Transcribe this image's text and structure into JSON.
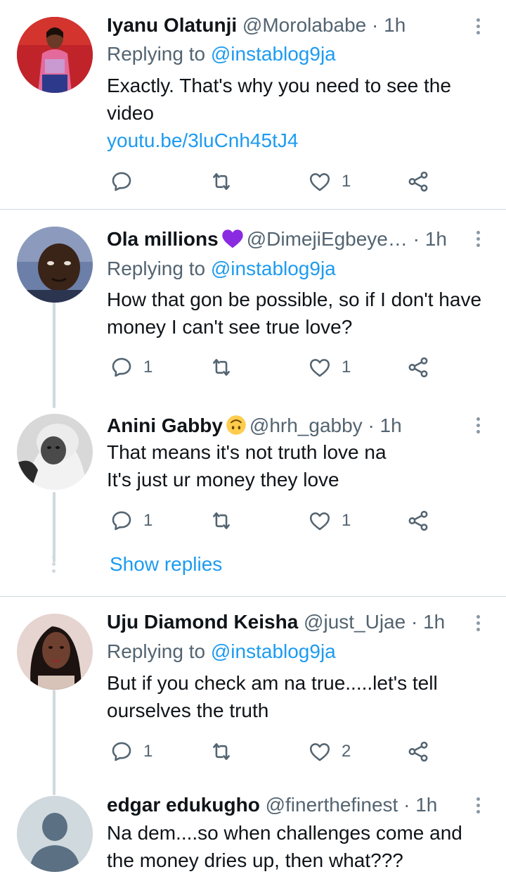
{
  "tweets": [
    {
      "name": "Iyanu Olatunji",
      "handle": "@Morolababe",
      "time": "· 1h",
      "replying_prefix": "Replying to ",
      "replying_to": "@instablog9ja",
      "text": "Exactly.  That's why you need to see the video",
      "link": "youtu.be/3luCnh45tJ4",
      "reply_count": "",
      "retweet_count": "",
      "like_count": "1"
    },
    {
      "name": "Ola millions",
      "handle": "@DimejiEgbeye…",
      "time": "· 1h",
      "replying_prefix": "Replying to ",
      "replying_to": "@instablog9ja",
      "text": "How that gon be possible, so if I don't have money I can't see true love?",
      "reply_count": "1",
      "retweet_count": "",
      "like_count": "1"
    },
    {
      "name": "Anini Gabby",
      "handle": "@hrh_gabby",
      "time": "· 1h",
      "text_line1": "That means it's not truth love na",
      "text_line2": "It's just ur money they love",
      "reply_count": "1",
      "retweet_count": "",
      "like_count": "1"
    },
    {
      "name": "Uju Diamond Keisha",
      "handle": "@just_Ujae",
      "time": "· 1h",
      "replying_prefix": "Replying to ",
      "replying_to": "@instablog9ja",
      "text": "But if you check  am na true.....let's tell ourselves the truth",
      "reply_count": "1",
      "retweet_count": "",
      "like_count": "2"
    },
    {
      "name": "edgar edukugho",
      "handle": "@finerthefinest",
      "time": "· 1h",
      "text": "Na dem....so when challenges come and the money dries up, then what???"
    }
  ],
  "show_replies": "Show replies",
  "icons": [
    "reply-icon",
    "retweet-icon",
    "like-icon",
    "share-icon",
    "more-icon",
    "purple-heart-emoji",
    "upside-down-face-emoji"
  ],
  "colors": {
    "accent": "#1d9bf0",
    "muted": "#536471",
    "divider": "#cfd9de"
  }
}
